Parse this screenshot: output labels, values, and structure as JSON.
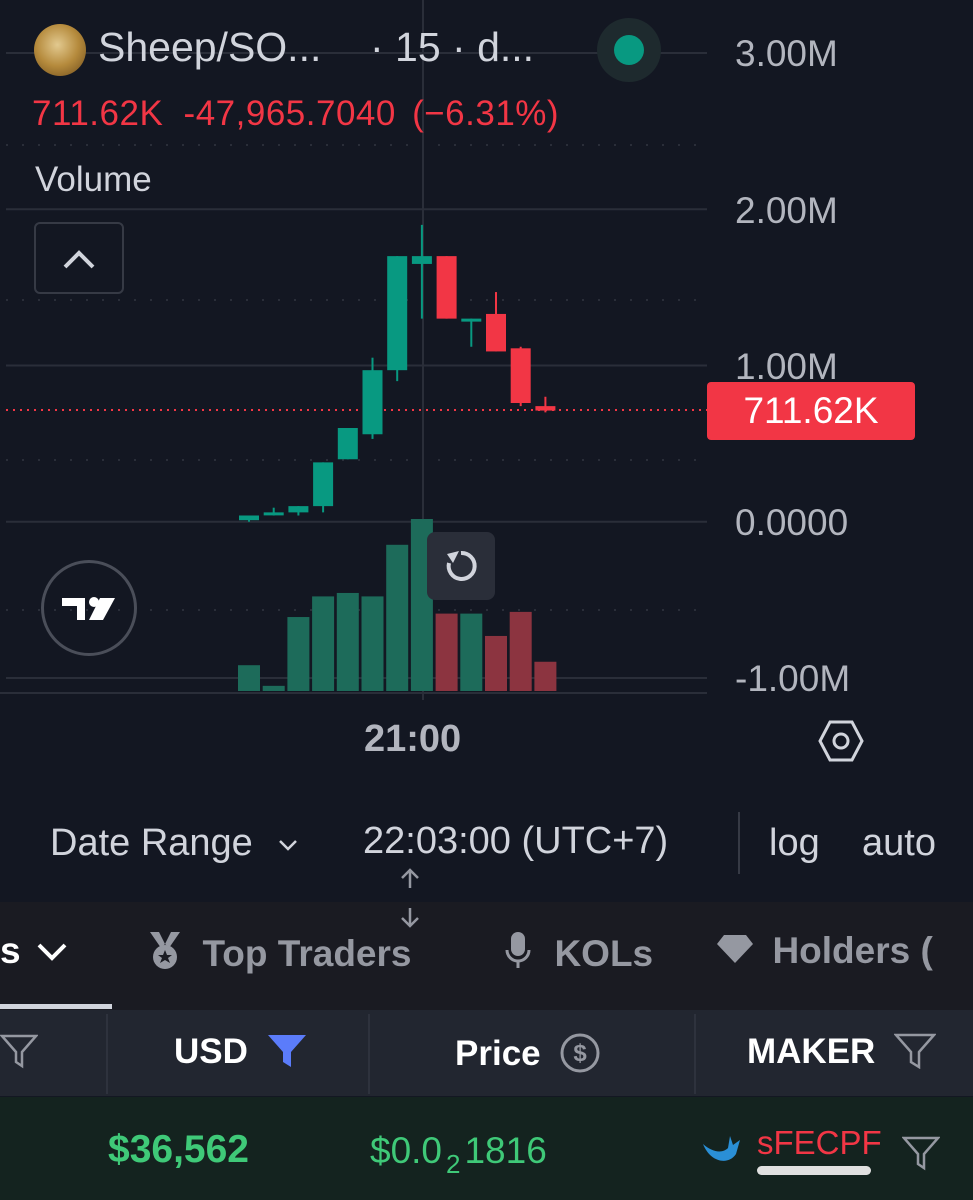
{
  "header": {
    "symbol": "Sheep/SO...",
    "interval": "· 15 · d...",
    "status_color": "#089981"
  },
  "ohlc": {
    "last": "711.62K",
    "change": "-47,965.7040",
    "change_pct": "(−6.31%)"
  },
  "volume_label": "Volume",
  "price_tag": "711.62K",
  "chart_data": {
    "type": "candlestick",
    "y_axis_labels": [
      "3.00M",
      "2.00M",
      "1.00M",
      "0.0000",
      "-1.00M"
    ],
    "ylim": [
      -1000000,
      3000000
    ],
    "x_tick_labels": [
      "21:00"
    ],
    "last_price": 711620,
    "candles": [
      {
        "o": 10000,
        "h": 30000,
        "l": 0,
        "c": 40000
      },
      {
        "o": 50000,
        "h": 90000,
        "l": 40000,
        "c": 60000
      },
      {
        "o": 60000,
        "h": 90000,
        "l": 40000,
        "c": 100000
      },
      {
        "o": 100000,
        "h": 220000,
        "l": 60000,
        "c": 380000
      },
      {
        "o": 400000,
        "h": 600000,
        "l": 400000,
        "c": 600000
      },
      {
        "o": 560000,
        "h": 1050000,
        "l": 530000,
        "c": 970000
      },
      {
        "o": 970000,
        "h": 1180000,
        "l": 900000,
        "c": 1700000
      },
      {
        "o": 1650000,
        "h": 1900000,
        "l": 1300000,
        "c": 1700000
      },
      {
        "o": 1700000,
        "h": 1690000,
        "l": 1300000,
        "c": 1300000
      },
      {
        "o": 1300000,
        "h": 1300000,
        "l": 1120000,
        "c": 1300000
      },
      {
        "o": 1330000,
        "h": 1470000,
        "l": 1090000,
        "c": 1090000
      },
      {
        "o": 1110000,
        "h": 1120000,
        "l": 740000,
        "c": 760000
      },
      {
        "o": 740000,
        "h": 800000,
        "l": 700000,
        "c": 711620
      }
    ],
    "volume": [
      0.15,
      0.03,
      0.43,
      0.55,
      0.57,
      0.55,
      0.85,
      1.0,
      0.45,
      0.45,
      0.32,
      0.46,
      0.17
    ]
  },
  "date_range_label": "Date Range",
  "timezone": "22:03:00 (UTC+7)",
  "log_label": "log",
  "auto_label": "auto",
  "tabs": [
    {
      "label": "s",
      "icon": "chevron-down-icon"
    },
    {
      "label": "Top Traders",
      "icon": "medal-icon"
    },
    {
      "label": "KOLs",
      "icon": "microphone-icon"
    },
    {
      "label": "Holders (",
      "icon": "diamond-icon"
    }
  ],
  "table": {
    "headers": [
      "USD",
      "Price",
      "MAKER"
    ],
    "row": {
      "usd": "$36,562",
      "price_prefix": "$0.0",
      "price_zeros": "2",
      "price_digits": "1816",
      "maker": "sFECPF"
    }
  },
  "colors": {
    "up": "#089981",
    "down": "#f23645",
    "background": "#131722",
    "accent_filter": "#5b7cfa",
    "positive_text": "#3fc978"
  }
}
